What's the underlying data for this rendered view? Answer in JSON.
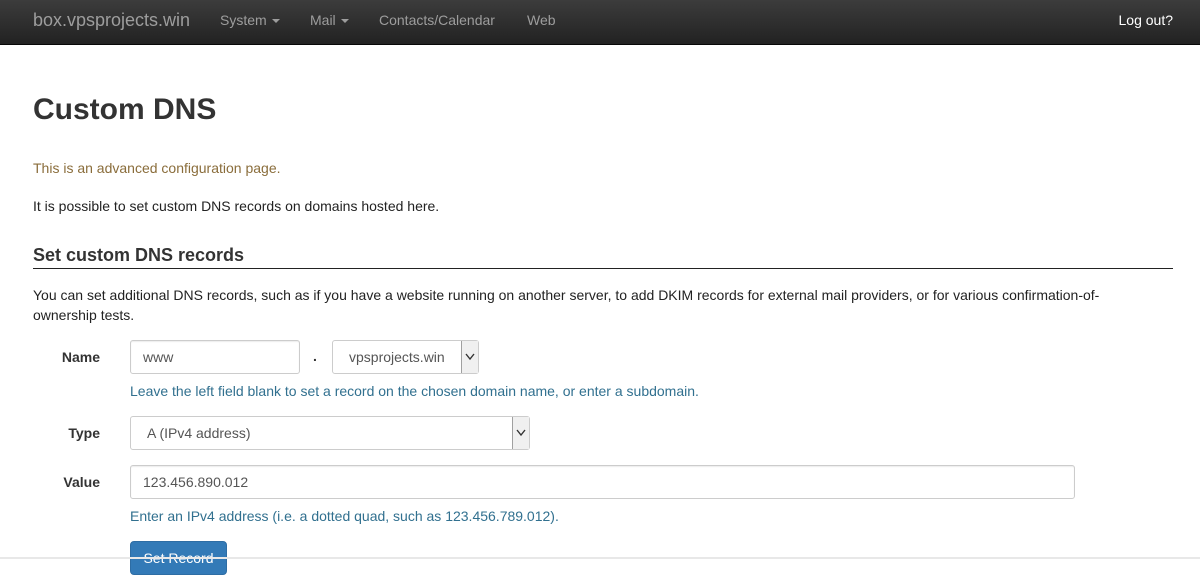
{
  "navbar": {
    "brand": "box.vpsprojects.win",
    "items": [
      {
        "label": "System",
        "dropdown": true
      },
      {
        "label": "Mail",
        "dropdown": true
      },
      {
        "label": "Contacts/Calendar",
        "dropdown": false
      },
      {
        "label": "Web",
        "dropdown": false
      }
    ],
    "logout": "Log out?"
  },
  "page": {
    "title": "Custom DNS",
    "warning": "This is an advanced configuration page.",
    "intro": "It is possible to set custom DNS records on domains hosted here."
  },
  "section": {
    "heading": "Set custom DNS records",
    "description": "You can set additional DNS records, such as if you have a website running on another server, to add DKIM records for external mail providers, or for various confirmation-of-ownership tests."
  },
  "form": {
    "name_label": "Name",
    "name_value": "www",
    "separator": ".",
    "domain_value": "vpsprojects.win",
    "name_help": "Leave the left field blank to set a record on the chosen domain name, or enter a subdomain.",
    "type_label": "Type",
    "type_value": "A (IPv4 address)",
    "value_label": "Value",
    "value_value": "123.456.890.012",
    "value_help": "Enter an IPv4 address (i.e. a dotted quad, such as 123.456.789.012).",
    "submit_label": "Set Record"
  },
  "colors": {
    "navbar_bg": "#222222",
    "warning_text": "#8a6d3b",
    "help_text": "#31708f",
    "primary_button": "#337ab7"
  }
}
